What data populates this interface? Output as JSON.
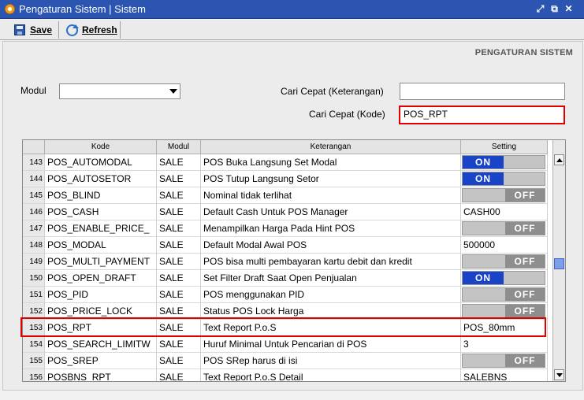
{
  "window": {
    "title": "Pengaturan Sistem | Sistem"
  },
  "toolbar": {
    "save_label": "Save",
    "refresh_label": "Refresh"
  },
  "panel": {
    "title": "PENGATURAN SISTEM"
  },
  "filters": {
    "modul_label": "Modul",
    "modul_value": "",
    "cari_keterangan_label": "Cari Cepat (Keterangan)",
    "cari_keterangan_value": "",
    "cari_kode_label": "Cari Cepat (Kode)",
    "cari_kode_value": "POS_RPT"
  },
  "table": {
    "headers": [
      "Kode",
      "Modul",
      "Keterangan",
      "Setting"
    ],
    "rows": [
      {
        "num": "143",
        "kode": "POS_AUTOMODAL",
        "modul": "SALE",
        "ket": "POS Buka Langsung Set Modal",
        "setting": "ON",
        "type": "on"
      },
      {
        "num": "144",
        "kode": "POS_AUTOSETOR",
        "modul": "SALE",
        "ket": "POS Tutup Langsung Setor",
        "setting": "ON",
        "type": "on"
      },
      {
        "num": "145",
        "kode": "POS_BLIND",
        "modul": "SALE",
        "ket": "Nominal tidak terlihat",
        "setting": "OFF",
        "type": "off"
      },
      {
        "num": "146",
        "kode": "POS_CASH",
        "modul": "SALE",
        "ket": "Default Cash Untuk POS Manager",
        "setting": "CASH00",
        "type": "text"
      },
      {
        "num": "147",
        "kode": "POS_ENABLE_PRICE_",
        "modul": "SALE",
        "ket": "Menampilkan Harga Pada Hint POS",
        "setting": "OFF",
        "type": "off"
      },
      {
        "num": "148",
        "kode": "POS_MODAL",
        "modul": "SALE",
        "ket": "Default Modal Awal POS",
        "setting": "500000",
        "type": "text"
      },
      {
        "num": "149",
        "kode": "POS_MULTI_PAYMENT",
        "modul": "SALE",
        "ket": "POS bisa multi pembayaran kartu debit dan kredit",
        "setting": "OFF",
        "type": "off"
      },
      {
        "num": "150",
        "kode": "POS_OPEN_DRAFT",
        "modul": "SALE",
        "ket": "Set Filter Draft Saat Open Penjualan",
        "setting": "ON",
        "type": "on"
      },
      {
        "num": "151",
        "kode": "POS_PID",
        "modul": "SALE",
        "ket": "POS menggunakan PID",
        "setting": "OFF",
        "type": "off"
      },
      {
        "num": "152",
        "kode": "POS_PRICE_LOCK",
        "modul": "SALE",
        "ket": "Status POS Lock Harga",
        "setting": "OFF",
        "type": "off"
      },
      {
        "num": "153",
        "kode": "POS_RPT",
        "modul": "SALE",
        "ket": "Text Report P.o.S",
        "setting": "POS_80mm",
        "type": "text"
      },
      {
        "num": "154",
        "kode": "POS_SEARCH_LIMITW",
        "modul": "SALE",
        "ket": "Huruf Minimal Untuk Pencarian di POS",
        "setting": "3",
        "type": "text"
      },
      {
        "num": "155",
        "kode": "POS_SREP",
        "modul": "SALE",
        "ket": "POS SRep harus di isi",
        "setting": "OFF",
        "type": "off"
      },
      {
        "num": "156",
        "kode": "POSBNS_RPT",
        "modul": "SALE",
        "ket": "Text Report P.o.S Detail",
        "setting": "SALEBNS",
        "type": "text"
      }
    ]
  }
}
